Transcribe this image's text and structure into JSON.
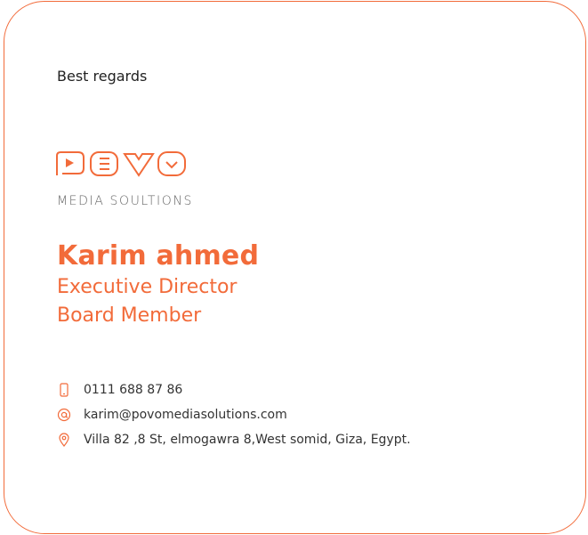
{
  "greeting": "Best regards",
  "logo": {
    "wordmark": "POVO",
    "tagline": "MEDIA SOULTIONS"
  },
  "person": {
    "name": "Karim ahmed",
    "title": "Executive Director",
    "role": "Board Member"
  },
  "contacts": {
    "phone": "0111 688 87 86",
    "email": "karim@povomediasolutions.com",
    "address": "Villa 82 ,8 St, elmogawra 8,West somid, Giza, Egypt."
  },
  "icons": {
    "phone": "phone-icon",
    "email": "at-sign-icon",
    "address": "location-pin-icon"
  },
  "colors": {
    "accent": "#f26b3a",
    "text": "#222222"
  }
}
